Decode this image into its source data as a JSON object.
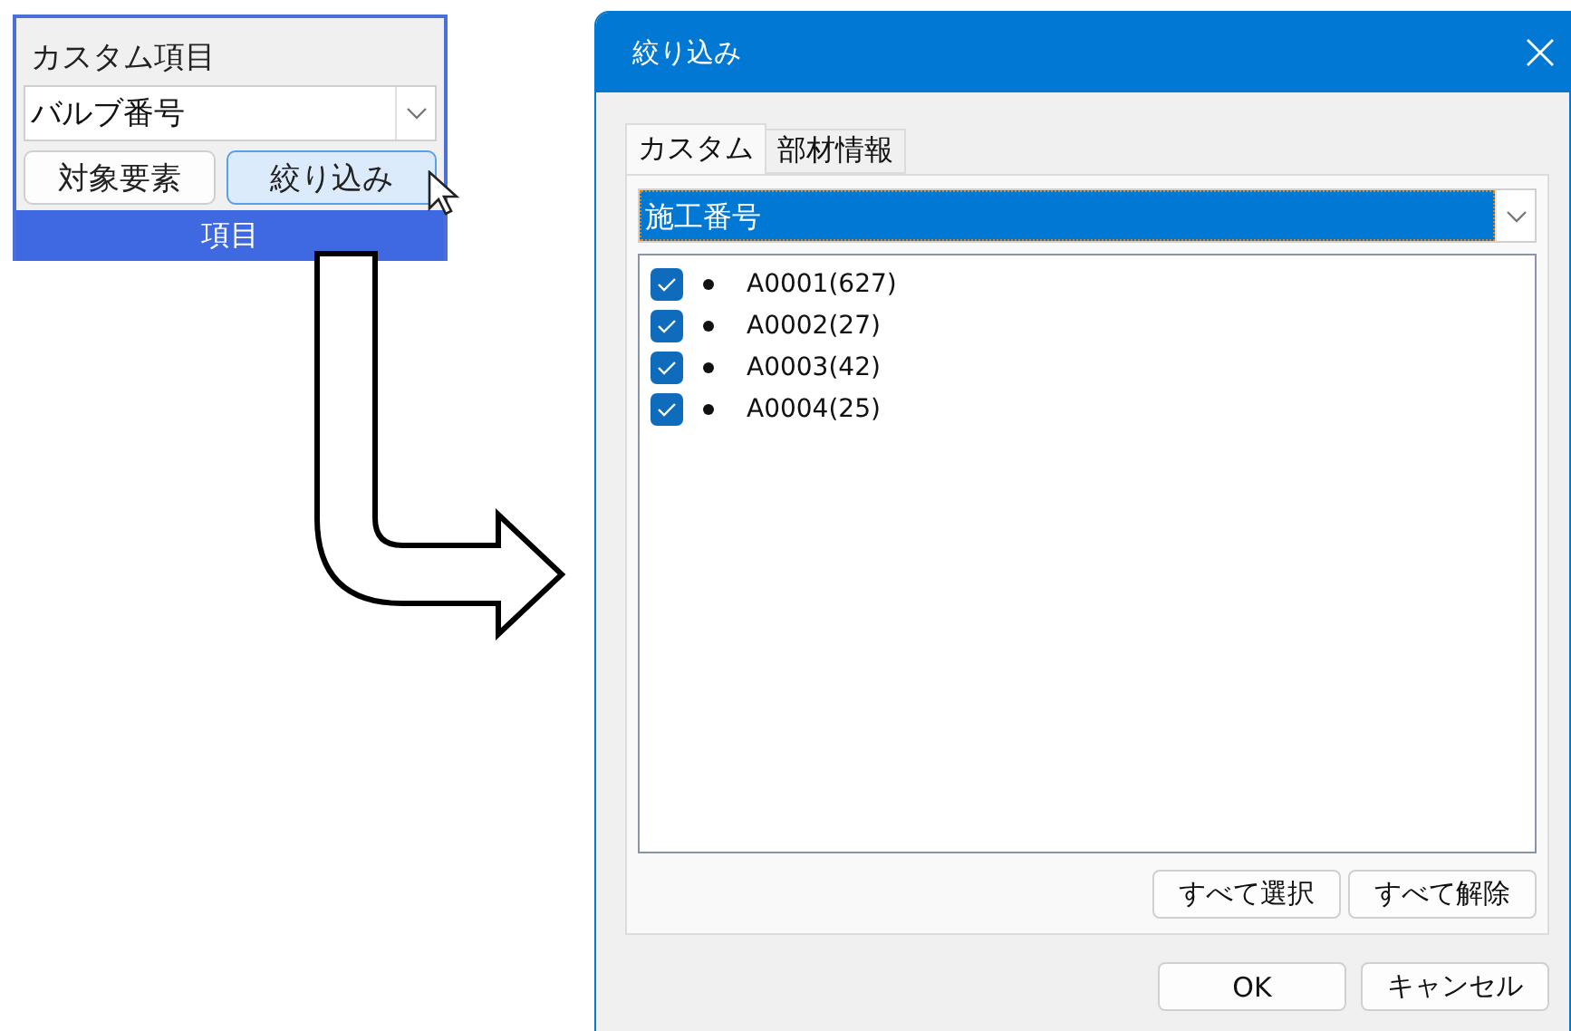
{
  "ribbon_panel": {
    "heading": "カスタム項目",
    "dropdown": {
      "value": "バルブ番号"
    },
    "buttons": [
      {
        "label": "対象要素",
        "hovered": false
      },
      {
        "label": "絞り込み",
        "hovered": true
      }
    ],
    "group_label": "項目"
  },
  "dialog": {
    "title": "絞り込み",
    "tabs": [
      {
        "label": "カスタム",
        "selected": true
      },
      {
        "label": "部材情報",
        "selected": false
      }
    ],
    "dropdown": {
      "value": "施工番号"
    },
    "items": [
      {
        "label": "A0001(627)",
        "checked": true
      },
      {
        "label": "A0002(27)",
        "checked": true
      },
      {
        "label": "A0003(42)",
        "checked": true
      },
      {
        "label": "A0004(25)",
        "checked": true
      }
    ],
    "list_buttons": [
      "すべて選択",
      "すべて解除"
    ],
    "buttons": [
      "OK",
      "キャンセル"
    ]
  }
}
